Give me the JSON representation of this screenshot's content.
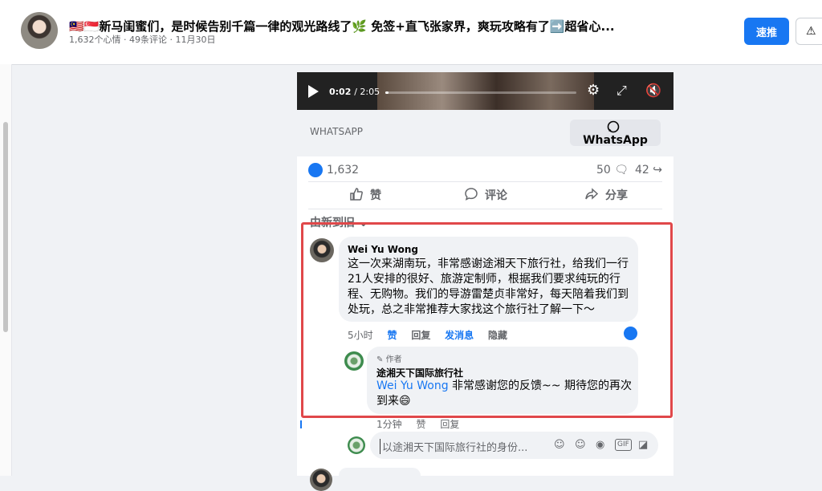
{
  "header": {
    "title": "🇲🇾🇸🇬新马闺蜜们，是时候告别千篇一律的观光路线了🌿 免签+直飞张家界，爽玩攻略有了➡️超省心...",
    "meta": "1,632个心情 · 49条评论 · 11月30日",
    "boost_label": "速推",
    "warn_label": "⚠"
  },
  "video": {
    "time_current": "0:02",
    "time_total": "/ 2:05",
    "progress": 0.016
  },
  "link": {
    "source": "WHATSAPP",
    "button_label": "WhatsApp"
  },
  "stats": {
    "reactions": "1,632",
    "comments": "50",
    "shares": "42"
  },
  "actions": {
    "like": "赞",
    "comment": "评论",
    "share": "分享"
  },
  "sort_label": "由新到旧",
  "comment": {
    "author": "Wei Yu Wong",
    "text": "这一次来湖南玩，非常感谢途湘天下旅行社，给我们一行21人安排的很好、旅游定制师，根据我们要求纯玩的行程、无购物。我们的导游雷楚贞非常好，每天陪着我们到处玩，总之非常推荐大家找这个旅行社了解一下～",
    "time": "5小时",
    "like": "赞",
    "reply": "回复",
    "message": "发消息",
    "hide": "隐藏"
  },
  "reply": {
    "badge": "作者",
    "author": "途湘天下国际旅行社",
    "mention": "Wei Yu Wong",
    "text": " 非常感谢您的反馈~~ 期待您的再次到来😄",
    "time": "1分钟",
    "like": "赞",
    "reply": "回复"
  },
  "reply_input": {
    "placeholder": "以途湘天下国际旅行社的身份..."
  },
  "colors": {
    "accent": "#1877f2",
    "highlight": "#e0484a"
  }
}
